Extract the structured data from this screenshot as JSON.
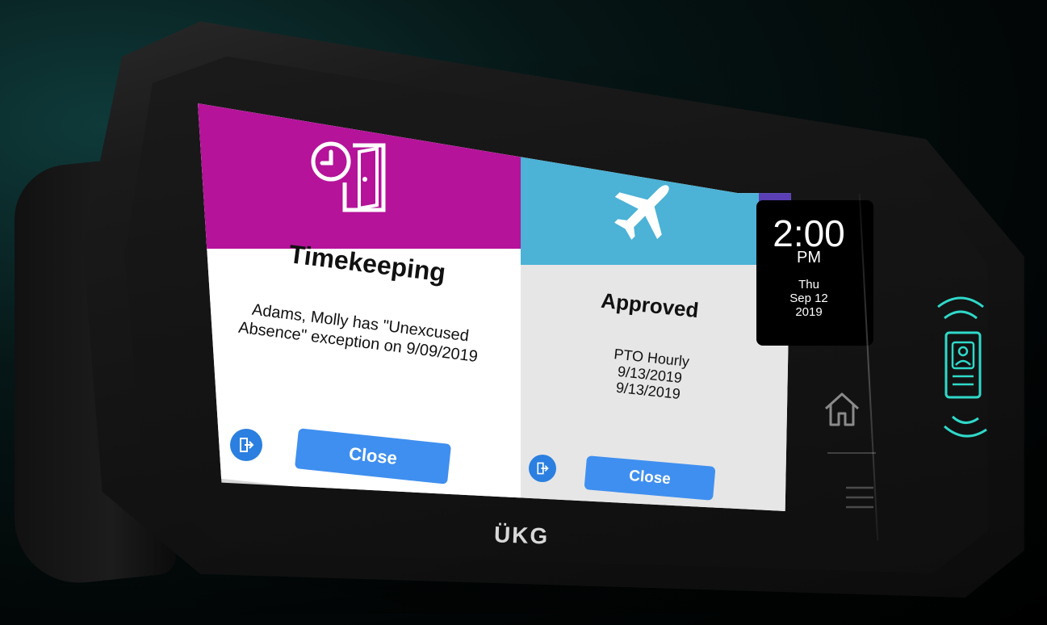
{
  "brand": {
    "logo": "ÜKG",
    "accent_colors": {
      "timekeeping_header": "#b5139a",
      "approved_header": "#4cb2d6",
      "approved_stripe": "#5b3fb4",
      "button_blue": "#3f8ff0",
      "reader_teal": "#2fd9c9"
    }
  },
  "cards": {
    "timekeeping": {
      "icon": "clock-door-icon",
      "title": "Timekeeping",
      "message": "Adams, Molly has \"Unexcused Absence\" exception on 9/09/2019",
      "exit_icon": "exit-icon",
      "close_label": "Close"
    },
    "approved": {
      "icon": "airplane-icon",
      "title": "Approved",
      "line1": "PTO Hourly",
      "line2": "9/13/2019",
      "line3": "9/13/2019",
      "exit_icon": "exit-icon",
      "close_label": "Close"
    }
  },
  "clock": {
    "time": "2:00",
    "ampm": "PM",
    "day": "Thu",
    "date": "Sep 12",
    "year": "2019"
  },
  "side_controls": {
    "home_icon": "home-icon",
    "menu_icon": "menu-icon",
    "badge_icon": "badge-reader-icon"
  }
}
